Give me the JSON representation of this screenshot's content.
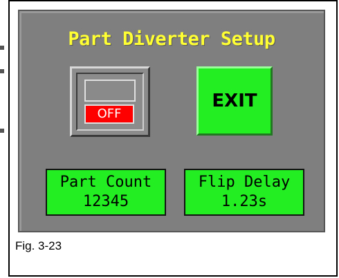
{
  "screen": {
    "title": "Part Diverter Setup",
    "background_color": "#7f7f7f",
    "title_color": "#ffff33"
  },
  "toggle": {
    "state_label": "OFF",
    "state_color": "#ff0000"
  },
  "exit_button": {
    "label": "EXIT",
    "color": "#22ee22"
  },
  "part_count": {
    "label": "Part Count",
    "value": "12345"
  },
  "flip_delay": {
    "label": "Flip Delay",
    "value": "1.23s"
  },
  "caption": {
    "text": "Fig. 3-23"
  }
}
